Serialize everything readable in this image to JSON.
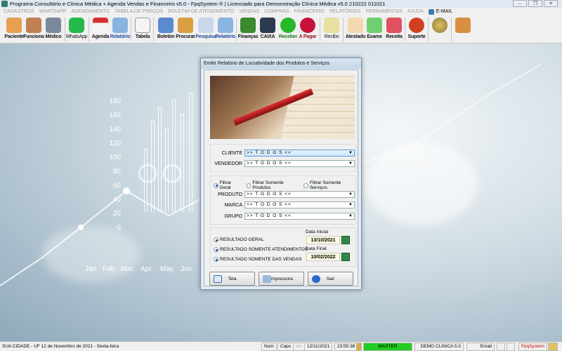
{
  "window": {
    "title": "Programa Consultório e Clínica Médica + Agenda Vendas e Financeiro v5.0 - FpqSystem ® | Licenciado para  Demonstração Clínica Médica v5.0 210222 011021"
  },
  "menu": [
    "CADASTROS",
    "WHATSAPP",
    "AGENDAMENTO",
    "TABELA DE PREÇOS",
    "BOLETIM DE ATENDIMENTO",
    "VENDAS",
    "COMPRAS",
    "FINANCEIRO",
    "RELATÓRIOS",
    "FERRAMENTAS",
    "AJUDA"
  ],
  "menu_email": "E-MAIL",
  "toolbar": [
    "Paciente",
    "Funciona",
    "Médico",
    "WhatsApp",
    "Agenda",
    "Relatório",
    "Tabela",
    "Boletim",
    "Procurar",
    "Pesquisa",
    "Relatório",
    "Finanças",
    "CAIXA",
    "Receber",
    "A Pagar",
    "Recibo",
    "Atestado",
    "Exame",
    "Receita",
    "Suporte",
    "",
    ""
  ],
  "background": {
    "y_ticks": [
      "180",
      "160",
      "140",
      "120",
      "100",
      "80",
      "60",
      "40",
      "20",
      "0"
    ],
    "months": [
      "Jan.",
      "Fab.",
      "Mar.",
      "Apr.",
      "May.",
      "Jun."
    ]
  },
  "dialog": {
    "title": "Emitir Relatório de Lucratividade dos Produtos e Serviços",
    "cliente_label": "CLIENTE",
    "cliente_value": ">> T O D O S <<",
    "vendedor_label": "VENDEDOR",
    "vendedor_value": ">> T O D O S <<",
    "filters": [
      "Filtrar Geral",
      "Filtrar Somente Produtos",
      "Filtrar Somente Serviços"
    ],
    "produto_label": "PRODUTO",
    "produto_value": ">> T O D O S <<",
    "marca_label": "MARCA",
    "marca_value": ">> T O D O S <<",
    "grupo_label": "GRUPO",
    "grupo_value": ">> T O D O S <<",
    "results": [
      "RESULTADO GERAL",
      "RESULTADO SOMENTE ATENDIMENTOS",
      "RESULTADO SOMENTE DAS VENDAS"
    ],
    "data_inicial_label": "Data Inicial",
    "data_inicial": "13/10/2021",
    "data_final_label": "Data Final",
    "data_final": "10/02/2022",
    "buttons": {
      "tela": "Tela",
      "impressora": "Impressora",
      "sair": "Sair"
    }
  },
  "status": {
    "location": "SUA CIDADE - UF 12 de Novembro de 2021 - Sexta-feira",
    "num": "Num",
    "caps": "Caps",
    "ins": "Ins",
    "date": "12/11/2021",
    "time": "23:55:38",
    "user": "MASTER",
    "company": "DEMO CLINICA 5.0",
    "email": "Email",
    "brand": "FpqSystem"
  },
  "colors": {
    "user_bg": "#22cc22",
    "accent": "#2a5a8a"
  }
}
